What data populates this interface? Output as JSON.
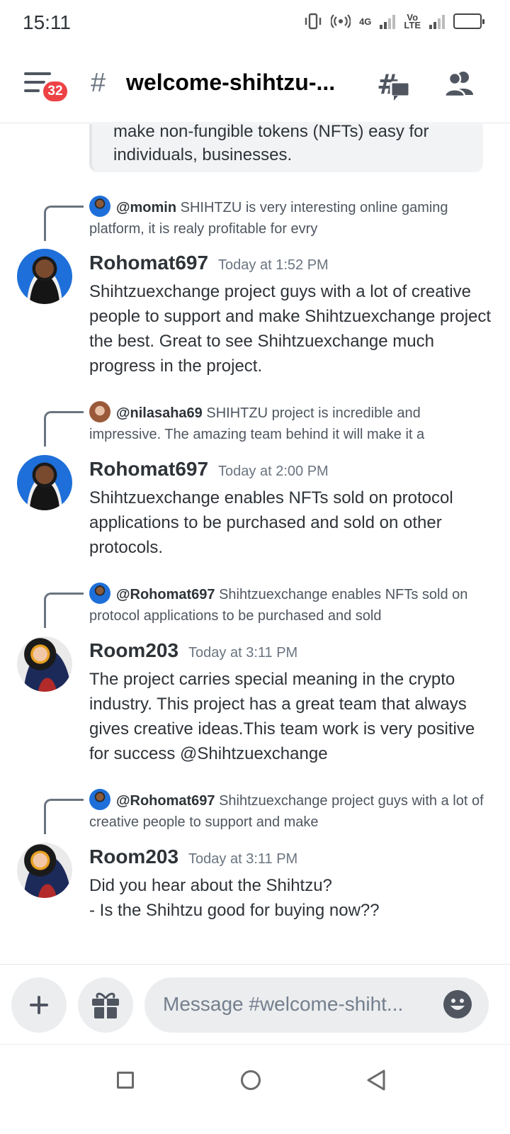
{
  "status_bar": {
    "time": "15:11",
    "net_4g": "4G",
    "net_volte": "Vo\nLTE"
  },
  "header": {
    "badge_count": "32",
    "hash": "#",
    "channel_name": "welcome-shihtzu-..."
  },
  "embed": {
    "text": "make non-fungible tokens (NFTs) easy for\nindividuals, businesses."
  },
  "messages": [
    {
      "reply": {
        "mention": "@momin",
        "text": "SHIHTZU is very interesting online gaming platform, it is realy profitable for evry"
      },
      "username": "Rohomat697",
      "timestamp": "Today at 1:52 PM",
      "body": "Shihtzuexchange  project guys with a lot of creative people to support and make Shihtzuexchange project the best. Great to see Shihtzuexchange  much progress in the project."
    },
    {
      "reply": {
        "mention": "@nilasaha69",
        "text": "SHIHTZU project is incredible and impressive. The amazing team behind it will make it a"
      },
      "username": "Rohomat697",
      "timestamp": "Today at 2:00 PM",
      "body": "Shihtzuexchange  enables NFTs sold on protocol applications to be purchased and sold on other protocols."
    },
    {
      "reply": {
        "mention": "@Rohomat697",
        "text": "Shihtzuexchange  enables NFTs sold on protocol applications to be purchased and sold"
      },
      "username": "Room203",
      "timestamp": "Today at 3:11 PM",
      "body": "The project carries special meaning in the crypto industry.  This project has a great team that always gives creative ideas.This team work is very positive for success @Shihtzuexchange"
    },
    {
      "reply": {
        "mention": "@Rohomat697",
        "text": "Shihtzuexchange  project guys with a lot of creative people to support and make"
      },
      "username": "Room203",
      "timestamp": "Today at 3:11 PM",
      "body": "Did you hear about the Shihtzu?\n- Is the Shihtzu good for buying now??"
    }
  ],
  "composer": {
    "placeholder": "Message #welcome-shiht..."
  },
  "colors": {
    "badge": "#ed4245",
    "avatar_blue": "#1e6fd9",
    "avatar_navy": "#1c2a5a"
  }
}
